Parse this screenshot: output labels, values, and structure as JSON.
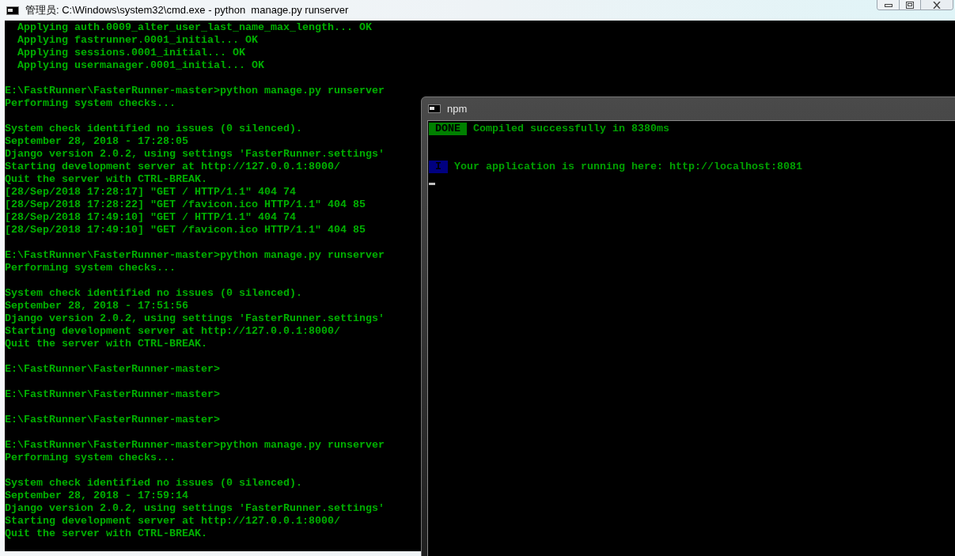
{
  "main_window": {
    "title": "管理员: C:\\Windows\\system32\\cmd.exe - python  manage.py runserver",
    "blocks": [
      [
        "  Applying auth.0009_alter_user_last_name_max_length... OK",
        "  Applying fastrunner.0001_initial... OK",
        "  Applying sessions.0001_initial... OK",
        "  Applying usermanager.0001_initial... OK"
      ],
      [
        "E:\\FastRunner\\FasterRunner-master>python manage.py runserver",
        "Performing system checks..."
      ],
      [
        "System check identified no issues (0 silenced).",
        "September 28, 2018 - 17:28:05",
        "Django version 2.0.2, using settings 'FasterRunner.settings'",
        "Starting development server at http://127.0.0.1:8000/",
        "Quit the server with CTRL-BREAK.",
        "[28/Sep/2018 17:28:17] \"GET / HTTP/1.1\" 404 74",
        "[28/Sep/2018 17:28:22] \"GET /favicon.ico HTTP/1.1\" 404 85",
        "[28/Sep/2018 17:49:10] \"GET / HTTP/1.1\" 404 74",
        "[28/Sep/2018 17:49:10] \"GET /favicon.ico HTTP/1.1\" 404 85"
      ],
      [
        "E:\\FastRunner\\FasterRunner-master>python manage.py runserver",
        "Performing system checks..."
      ],
      [
        "System check identified no issues (0 silenced).",
        "September 28, 2018 - 17:51:56",
        "Django version 2.0.2, using settings 'FasterRunner.settings'",
        "Starting development server at http://127.0.0.1:8000/",
        "Quit the server with CTRL-BREAK."
      ],
      [
        "E:\\FastRunner\\FasterRunner-master>"
      ],
      [
        "E:\\FastRunner\\FasterRunner-master>"
      ],
      [
        "E:\\FastRunner\\FasterRunner-master>"
      ],
      [
        "E:\\FastRunner\\FasterRunner-master>python manage.py runserver",
        "Performing system checks..."
      ],
      [
        "System check identified no issues (0 silenced).",
        "September 28, 2018 - 17:59:14",
        "Django version 2.0.2, using settings 'FasterRunner.settings'",
        "Starting development server at http://127.0.0.1:8000/",
        "Quit the server with CTRL-BREAK."
      ]
    ]
  },
  "npm_window": {
    "title": "npm",
    "messages": [
      {
        "badge": "DONE",
        "color": "#008000",
        "text": "Compiled successfully in 8380ms"
      },
      {
        "badge": "I",
        "color": "#000080",
        "text": "Your application is running here: http://localhost:8081"
      }
    ]
  }
}
